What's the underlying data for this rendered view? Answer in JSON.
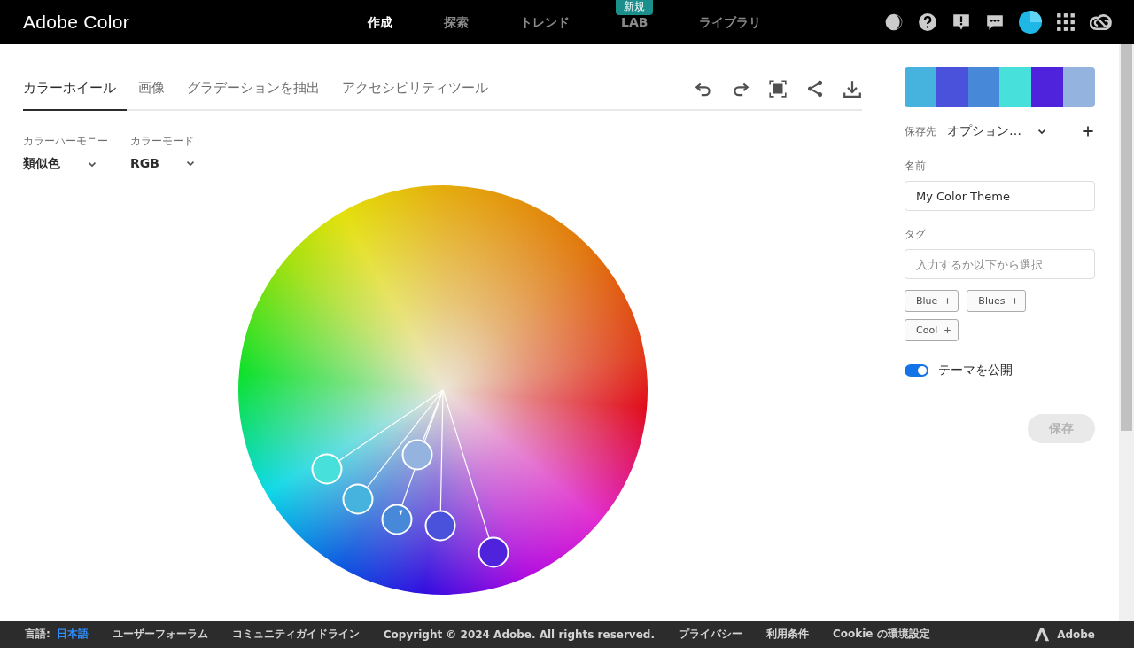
{
  "header": {
    "brand": "Adobe Color",
    "nav": [
      {
        "label": "作成",
        "selected": true
      },
      {
        "label": "探索",
        "selected": false
      },
      {
        "label": "トレンド",
        "selected": false
      },
      {
        "label": "LAB",
        "selected": false,
        "badge": "新規"
      },
      {
        "label": "ライブラリ",
        "selected": false
      }
    ]
  },
  "tabs": [
    {
      "label": "カラーホイール",
      "selected": true
    },
    {
      "label": "画像",
      "selected": false
    },
    {
      "label": "グラデーションを抽出",
      "selected": false
    },
    {
      "label": "アクセシビリティツール",
      "selected": false
    }
  ],
  "harmony": {
    "label": "カラーハーモニー",
    "value": "類似色"
  },
  "mode": {
    "label": "カラーモード",
    "value": "RGB"
  },
  "handles": [
    {
      "color": "#48e0da",
      "kind": "normal"
    },
    {
      "color": "#46b3df",
      "kind": "normal"
    },
    {
      "color": "#94b3df",
      "kind": "normal"
    },
    {
      "color": "#4788d9",
      "kind": "base"
    },
    {
      "color": "#4a52dc",
      "kind": "normal"
    },
    {
      "color": "#4f22dc",
      "kind": "normal"
    }
  ],
  "swatches": [
    {
      "color": "#46b3df"
    },
    {
      "color": "#4a52dc"
    },
    {
      "color": "#4788d9"
    },
    {
      "color": "#48e0da"
    },
    {
      "color": "#4f22dc"
    },
    {
      "color": "#94b3df"
    }
  ],
  "save_to": {
    "label": "保存先",
    "value": "オプション…"
  },
  "name": {
    "label": "名前",
    "value": "My Color Theme"
  },
  "tags": {
    "label": "タグ",
    "placeholder": "入力するか以下から選択",
    "suggestions": [
      "Blue",
      "Blues",
      "Cool"
    ]
  },
  "publish": {
    "label": "テーマを公開",
    "on": true
  },
  "save_button": {
    "label": "保存",
    "disabled": true
  },
  "footer": {
    "language_label": "言語:",
    "language": "日本語",
    "links": [
      "ユーザーフォーラム",
      "コミュニティガイドライン",
      "Copyright © 2024 Adobe. All rights reserved.",
      "プライバシー",
      "利用条件",
      "Cookie の環境設定"
    ],
    "brand": "Adobe"
  }
}
